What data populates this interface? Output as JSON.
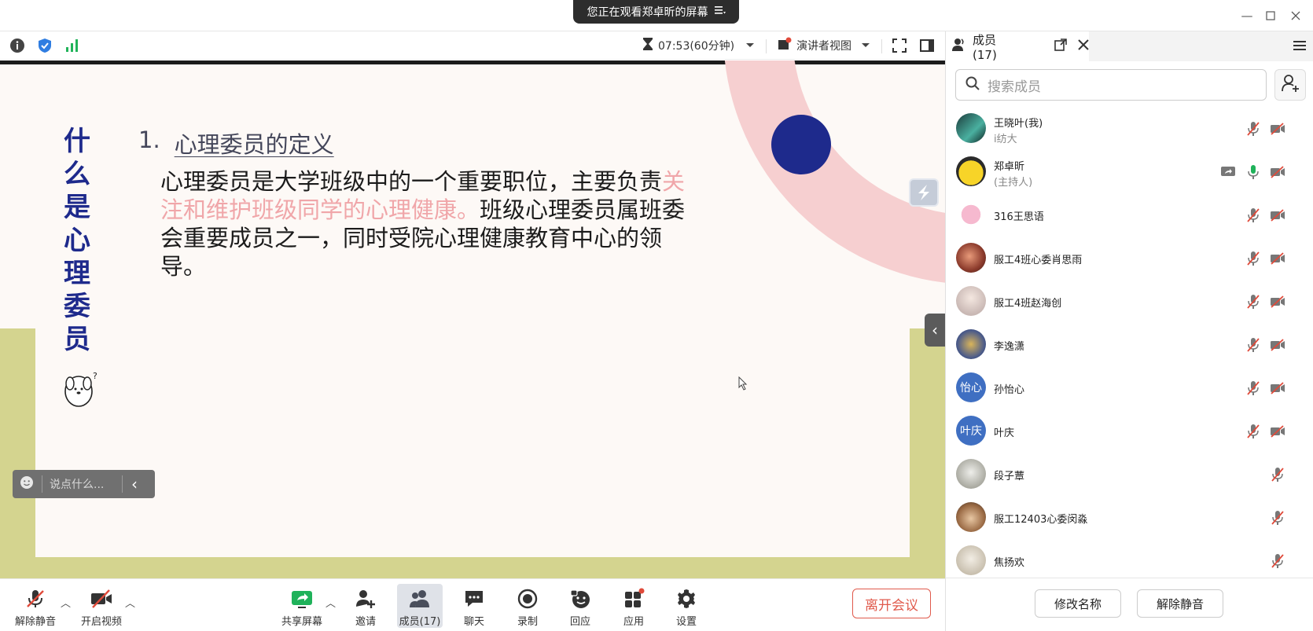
{
  "banner": {
    "text": "您正在观看郑卓昕的屏幕"
  },
  "toolbar": {
    "timer": "07:53(60分钟)",
    "view_mode": "演讲者视图"
  },
  "slide": {
    "vertical_title": [
      "什",
      "么",
      "是",
      "心",
      "理",
      "委",
      "员"
    ],
    "heading_number": "1.",
    "heading_text": "心理委员的定义",
    "body_part1": "心理委员是大学班级中的一个重要职位，主要负责",
    "body_highlight": "关注和维护班级同学的心理健康。",
    "body_part2": "班级心理委员属班委会重要成员之一，同时受院心理健康教育中心的领导。"
  },
  "chat": {
    "placeholder": "说点什么..."
  },
  "bottom": {
    "unmute": "解除静音",
    "start_video": "开启视频",
    "share": "共享屏幕",
    "invite": "邀请",
    "members": "成员(17)",
    "chat": "聊天",
    "record": "录制",
    "reply": "回应",
    "apps": "应用",
    "settings": "设置",
    "leave": "离开会议"
  },
  "panel": {
    "tab_label": "成员(17)",
    "search_placeholder": "搜索成员",
    "members": [
      {
        "name": "王晓叶(我)",
        "sub": "i纺大",
        "avatar": "photo",
        "mic": "muted",
        "video": "off"
      },
      {
        "name": "郑卓昕",
        "sub": "(主持人)",
        "avatar": "pikachu",
        "share": true,
        "mic": "on",
        "video": "off"
      },
      {
        "name": "316王思语",
        "sub": "",
        "avatar": "pink",
        "mic": "muted",
        "video": "off"
      },
      {
        "name": "服工4班心委肖思雨",
        "sub": "",
        "avatar": "photo2",
        "mic": "muted",
        "video": "off"
      },
      {
        "name": "服工4班赵海创",
        "sub": "",
        "avatar": "photo3",
        "mic": "muted",
        "video": "off"
      },
      {
        "name": "李逸潇",
        "sub": "",
        "avatar": "photo4",
        "mic": "muted",
        "video": "off"
      },
      {
        "name": "孙怡心",
        "sub": "",
        "avatar_text": "怡心",
        "mic": "muted",
        "video": "off"
      },
      {
        "name": "叶庆",
        "sub": "",
        "avatar_text": "叶庆",
        "mic": "muted",
        "video": "off"
      },
      {
        "name": "段子蕈",
        "sub": "",
        "avatar": "photo5",
        "mic": "muted"
      },
      {
        "name": "服工12403心委闵淼",
        "sub": "",
        "avatar": "cat",
        "mic": "muted"
      },
      {
        "name": "焦扬欢",
        "sub": "",
        "avatar": "photo6",
        "mic": "muted"
      }
    ],
    "rename_button": "修改名称",
    "unmute_button": "解除静音"
  },
  "colors": {
    "accent_blue": "#1e2a8c",
    "leave_red": "#e05a4c",
    "highlight_pink": "#f0a6a9",
    "avatar_blue": "#3f6fc2"
  }
}
